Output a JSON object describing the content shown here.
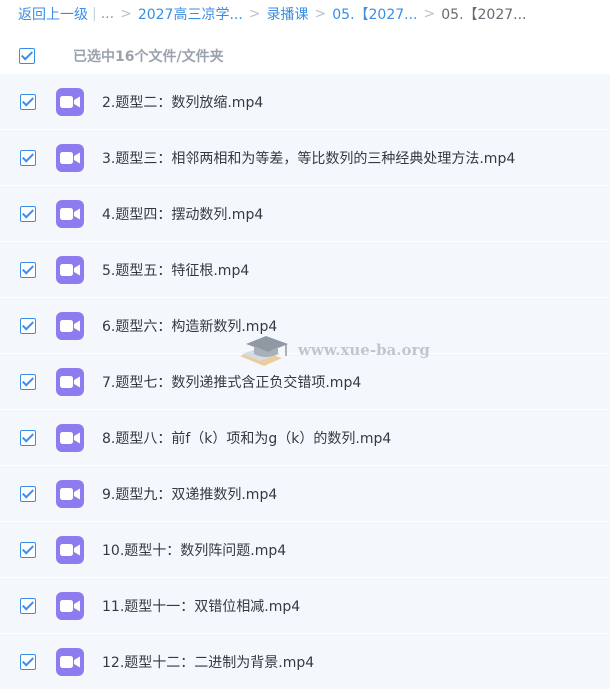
{
  "breadcrumb": {
    "back": "返回上一级",
    "ellipsis": "...",
    "items": [
      "2027高三凉学...",
      "录播课",
      "05.【2027..."
    ],
    "current": "05.【2027..."
  },
  "selection": {
    "label": "已选中16个文件/文件夹"
  },
  "files": [
    {
      "name": "2.题型二：数列放缩.mp4"
    },
    {
      "name": "3.题型三：相邻两相和为等差，等比数列的三种经典处理方法.mp4"
    },
    {
      "name": "4.题型四：摆动数列.mp4"
    },
    {
      "name": "5.题型五：特征根.mp4"
    },
    {
      "name": "6.题型六：构造新数列.mp4"
    },
    {
      "name": "7.题型七：数列递推式含正负交错项.mp4"
    },
    {
      "name": "8.题型八：前f（k）项和为g（k）的数列.mp4"
    },
    {
      "name": "9.题型九：双递推数列.mp4"
    },
    {
      "name": "10.题型十：数列阵问题.mp4"
    },
    {
      "name": "11.题型十一：双错位相减.mp4"
    },
    {
      "name": "12.题型十二：二进制为背景.mp4"
    }
  ],
  "watermark": "www.xue-ba.org",
  "colors": {
    "accent": "#3a8ee6",
    "row_bg": "#f4f8fd",
    "video_icon": "#8c7cf0"
  }
}
